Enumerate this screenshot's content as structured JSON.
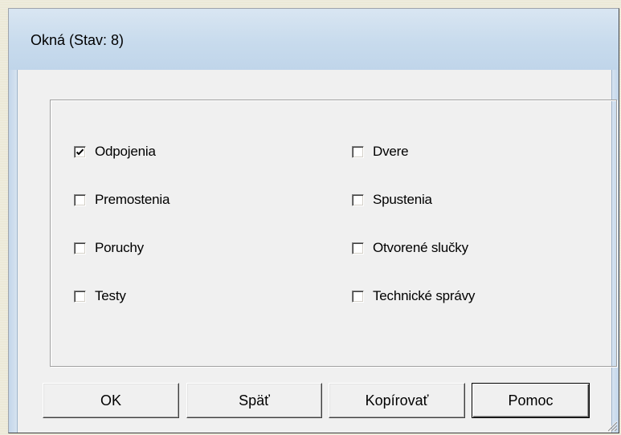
{
  "window": {
    "title": "Okná (Stav: 8)"
  },
  "checkboxes": {
    "left": [
      {
        "label": "Odpojenia",
        "checked": true
      },
      {
        "label": "Premostenia",
        "checked": false
      },
      {
        "label": "Poruchy",
        "checked": false
      },
      {
        "label": "Testy",
        "checked": false
      }
    ],
    "right": [
      {
        "label": "Dvere",
        "checked": false
      },
      {
        "label": "Spustenia",
        "checked": false
      },
      {
        "label": "Otvorené slučky",
        "checked": false
      },
      {
        "label": "Technické správy",
        "checked": false
      }
    ]
  },
  "buttons": {
    "ok": "OK",
    "back": "Späť",
    "copy": "Kopírovať",
    "help": "Pomoc"
  },
  "icons": {
    "check": "check-mark-icon",
    "resize": "resize-grip-icon"
  },
  "colors": {
    "titlebar": "#c8dbed",
    "face": "#f0f0f0",
    "desktop": "#ece9d8"
  }
}
